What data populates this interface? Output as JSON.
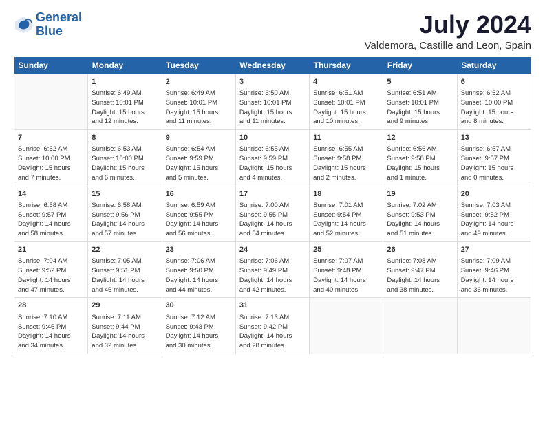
{
  "header": {
    "logo_line1": "General",
    "logo_line2": "Blue",
    "month_year": "July 2024",
    "location": "Valdemora, Castille and Leon, Spain"
  },
  "weekdays": [
    "Sunday",
    "Monday",
    "Tuesday",
    "Wednesday",
    "Thursday",
    "Friday",
    "Saturday"
  ],
  "weeks": [
    [
      {
        "day": "",
        "info": ""
      },
      {
        "day": "1",
        "info": "Sunrise: 6:49 AM\nSunset: 10:01 PM\nDaylight: 15 hours\nand 12 minutes."
      },
      {
        "day": "2",
        "info": "Sunrise: 6:49 AM\nSunset: 10:01 PM\nDaylight: 15 hours\nand 11 minutes."
      },
      {
        "day": "3",
        "info": "Sunrise: 6:50 AM\nSunset: 10:01 PM\nDaylight: 15 hours\nand 11 minutes."
      },
      {
        "day": "4",
        "info": "Sunrise: 6:51 AM\nSunset: 10:01 PM\nDaylight: 15 hours\nand 10 minutes."
      },
      {
        "day": "5",
        "info": "Sunrise: 6:51 AM\nSunset: 10:01 PM\nDaylight: 15 hours\nand 9 minutes."
      },
      {
        "day": "6",
        "info": "Sunrise: 6:52 AM\nSunset: 10:00 PM\nDaylight: 15 hours\nand 8 minutes."
      }
    ],
    [
      {
        "day": "7",
        "info": "Sunrise: 6:52 AM\nSunset: 10:00 PM\nDaylight: 15 hours\nand 7 minutes."
      },
      {
        "day": "8",
        "info": "Sunrise: 6:53 AM\nSunset: 10:00 PM\nDaylight: 15 hours\nand 6 minutes."
      },
      {
        "day": "9",
        "info": "Sunrise: 6:54 AM\nSunset: 9:59 PM\nDaylight: 15 hours\nand 5 minutes."
      },
      {
        "day": "10",
        "info": "Sunrise: 6:55 AM\nSunset: 9:59 PM\nDaylight: 15 hours\nand 4 minutes."
      },
      {
        "day": "11",
        "info": "Sunrise: 6:55 AM\nSunset: 9:58 PM\nDaylight: 15 hours\nand 2 minutes."
      },
      {
        "day": "12",
        "info": "Sunrise: 6:56 AM\nSunset: 9:58 PM\nDaylight: 15 hours\nand 1 minute."
      },
      {
        "day": "13",
        "info": "Sunrise: 6:57 AM\nSunset: 9:57 PM\nDaylight: 15 hours\nand 0 minutes."
      }
    ],
    [
      {
        "day": "14",
        "info": "Sunrise: 6:58 AM\nSunset: 9:57 PM\nDaylight: 14 hours\nand 58 minutes."
      },
      {
        "day": "15",
        "info": "Sunrise: 6:58 AM\nSunset: 9:56 PM\nDaylight: 14 hours\nand 57 minutes."
      },
      {
        "day": "16",
        "info": "Sunrise: 6:59 AM\nSunset: 9:55 PM\nDaylight: 14 hours\nand 56 minutes."
      },
      {
        "day": "17",
        "info": "Sunrise: 7:00 AM\nSunset: 9:55 PM\nDaylight: 14 hours\nand 54 minutes."
      },
      {
        "day": "18",
        "info": "Sunrise: 7:01 AM\nSunset: 9:54 PM\nDaylight: 14 hours\nand 52 minutes."
      },
      {
        "day": "19",
        "info": "Sunrise: 7:02 AM\nSunset: 9:53 PM\nDaylight: 14 hours\nand 51 minutes."
      },
      {
        "day": "20",
        "info": "Sunrise: 7:03 AM\nSunset: 9:52 PM\nDaylight: 14 hours\nand 49 minutes."
      }
    ],
    [
      {
        "day": "21",
        "info": "Sunrise: 7:04 AM\nSunset: 9:52 PM\nDaylight: 14 hours\nand 47 minutes."
      },
      {
        "day": "22",
        "info": "Sunrise: 7:05 AM\nSunset: 9:51 PM\nDaylight: 14 hours\nand 46 minutes."
      },
      {
        "day": "23",
        "info": "Sunrise: 7:06 AM\nSunset: 9:50 PM\nDaylight: 14 hours\nand 44 minutes."
      },
      {
        "day": "24",
        "info": "Sunrise: 7:06 AM\nSunset: 9:49 PM\nDaylight: 14 hours\nand 42 minutes."
      },
      {
        "day": "25",
        "info": "Sunrise: 7:07 AM\nSunset: 9:48 PM\nDaylight: 14 hours\nand 40 minutes."
      },
      {
        "day": "26",
        "info": "Sunrise: 7:08 AM\nSunset: 9:47 PM\nDaylight: 14 hours\nand 38 minutes."
      },
      {
        "day": "27",
        "info": "Sunrise: 7:09 AM\nSunset: 9:46 PM\nDaylight: 14 hours\nand 36 minutes."
      }
    ],
    [
      {
        "day": "28",
        "info": "Sunrise: 7:10 AM\nSunset: 9:45 PM\nDaylight: 14 hours\nand 34 minutes."
      },
      {
        "day": "29",
        "info": "Sunrise: 7:11 AM\nSunset: 9:44 PM\nDaylight: 14 hours\nand 32 minutes."
      },
      {
        "day": "30",
        "info": "Sunrise: 7:12 AM\nSunset: 9:43 PM\nDaylight: 14 hours\nand 30 minutes."
      },
      {
        "day": "31",
        "info": "Sunrise: 7:13 AM\nSunset: 9:42 PM\nDaylight: 14 hours\nand 28 minutes."
      },
      {
        "day": "",
        "info": ""
      },
      {
        "day": "",
        "info": ""
      },
      {
        "day": "",
        "info": ""
      }
    ]
  ]
}
